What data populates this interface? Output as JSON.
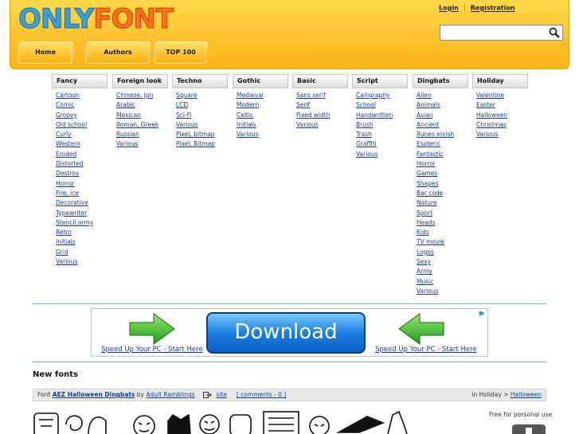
{
  "header": {
    "logo_part1": "ONLY",
    "logo_part2": "FONT",
    "login": "Login",
    "registration": "Registration",
    "search_placeholder": "",
    "nav": [
      "Home",
      "Authors",
      "TOP 100"
    ]
  },
  "categories": [
    {
      "title": "Fancy",
      "items": [
        "Cartoon",
        "Comic",
        "Groovy",
        "Old school",
        "Curly",
        "Western",
        "Eroded",
        "Distorted",
        "Destroy",
        "Horror",
        "Fire, ice",
        "Decorative",
        "Typewriter",
        "Stencil army",
        "Retro",
        "Initials",
        "Grid",
        "Various"
      ]
    },
    {
      "title": "Foreign look",
      "items": [
        "Chinese, Jpn",
        "Arabic",
        "Mexican",
        "Roman, Greek",
        "Russian",
        "Various"
      ]
    },
    {
      "title": "Techno",
      "items": [
        "Square",
        "LCD",
        "Sci-Fi",
        "Various",
        "Pixel, bitmap",
        "Pixel, Bitmap"
      ]
    },
    {
      "title": "Gothic",
      "items": [
        "Medieval",
        "Modern",
        "Celtic",
        "Initials",
        "Various"
      ]
    },
    {
      "title": "Basic",
      "items": [
        "Sans serif",
        "Serif",
        "Fixed width",
        "Various"
      ]
    },
    {
      "title": "Script",
      "items": [
        "Calligraphy",
        "School",
        "Handwritten",
        "Brush",
        "Trash",
        "Graffiti",
        "Various"
      ]
    },
    {
      "title": "Dingbats",
      "items": [
        "Alien",
        "Animals",
        "Asian",
        "Ancient",
        "Runes elvish",
        "Esoteric",
        "Fantastic",
        "Horror",
        "Games",
        "Shapes",
        "Bar code",
        "Nature",
        "Sport",
        "Heads",
        "Kids",
        "TV movie",
        "Logos",
        "Sexy",
        "Army",
        "Music",
        "Various"
      ]
    },
    {
      "title": "Holiday",
      "items": [
        "Valentine",
        "Easter",
        "Halloween",
        "Christmas",
        "Various"
      ]
    }
  ],
  "ad": {
    "button_text": "Download",
    "link_left": "Speed Up Your PC - Start Here",
    "link_right": "Speed Up Your PC - Start Here"
  },
  "new_fonts_heading": "New fonts",
  "font_entry": {
    "prefix": "Font",
    "name": "AEZ Halloween Dingbats",
    "by": "by",
    "author": "Adult Ramblings",
    "site": "site",
    "comments": "[ comments - 0 ]",
    "in_label": "in Holiday >",
    "category": "Halloween",
    "license": "Free for personal use"
  },
  "icons": [
    "search-icon",
    "adchoices-icon",
    "arrow-right-icon",
    "arrow-left-icon",
    "site-icon",
    "download-icon"
  ],
  "colors": {
    "header_bg": "#ffc52e",
    "logo_blue": "#3e9fd8",
    "logo_orange": "#ff6f14",
    "link": "#1a3b8a",
    "divider": "#6eb8c6"
  }
}
